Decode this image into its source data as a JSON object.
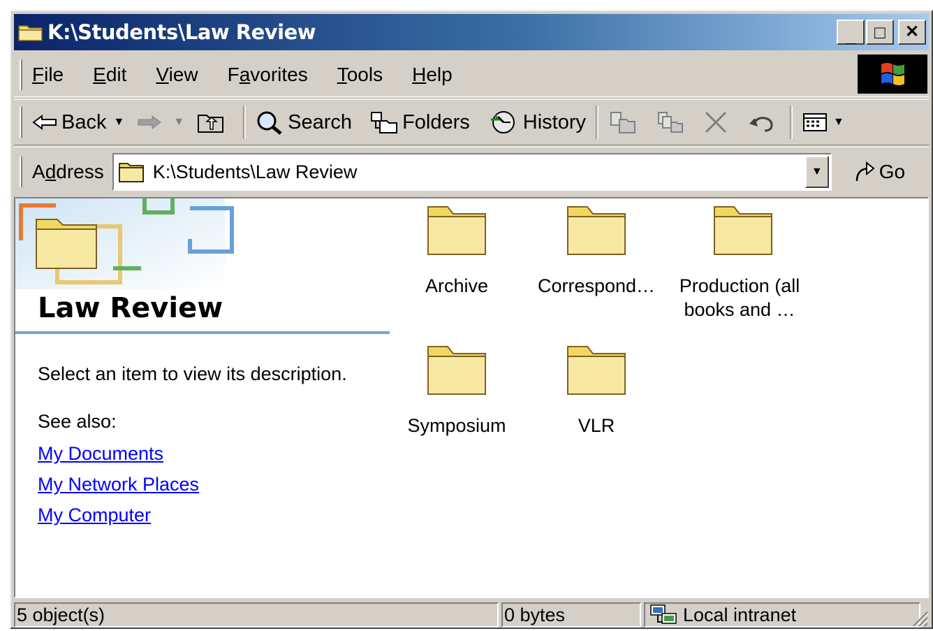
{
  "window": {
    "title": "K:\\Students\\Law Review",
    "minimize": "_",
    "maximize": "□",
    "close": "✕"
  },
  "menu": {
    "items": [
      {
        "key": "F",
        "rest": "ile"
      },
      {
        "key": "E",
        "rest": "dit"
      },
      {
        "key": "V",
        "rest": "iew"
      },
      {
        "pre": "F",
        "key": "a",
        "rest": "vorites"
      },
      {
        "key": "T",
        "rest": "ools"
      },
      {
        "key": "H",
        "rest": "elp"
      }
    ]
  },
  "toolbar": {
    "back": "Back",
    "search": "Search",
    "folders": "Folders",
    "history": "History"
  },
  "address": {
    "label_pre": "A",
    "label_key": "d",
    "label_rest": "dress",
    "value": "K:\\Students\\Law Review",
    "go": "Go"
  },
  "left_pane": {
    "title": "Law Review",
    "description": "Select an item to view its description.",
    "see_also": "See also:",
    "links": [
      "My Documents",
      "My Network Places",
      "My Computer"
    ]
  },
  "folders": [
    {
      "label_line1": "Archive",
      "label_line2": ""
    },
    {
      "label_line1": "Correspond…",
      "label_line2": ""
    },
    {
      "label_line1": "Production (all",
      "label_line2": "books and …"
    },
    {
      "label_line1": "Symposium",
      "label_line2": ""
    },
    {
      "label_line1": "VLR",
      "label_line2": ""
    }
  ],
  "status": {
    "objects": "5 object(s)",
    "size": "0 bytes",
    "zone": "Local intranet"
  },
  "colors": {
    "title_start": "#0a246a",
    "title_end": "#a6caf0",
    "chrome": "#d4d0c8",
    "link": "#0000ff",
    "folder": "#f7e9a3"
  }
}
